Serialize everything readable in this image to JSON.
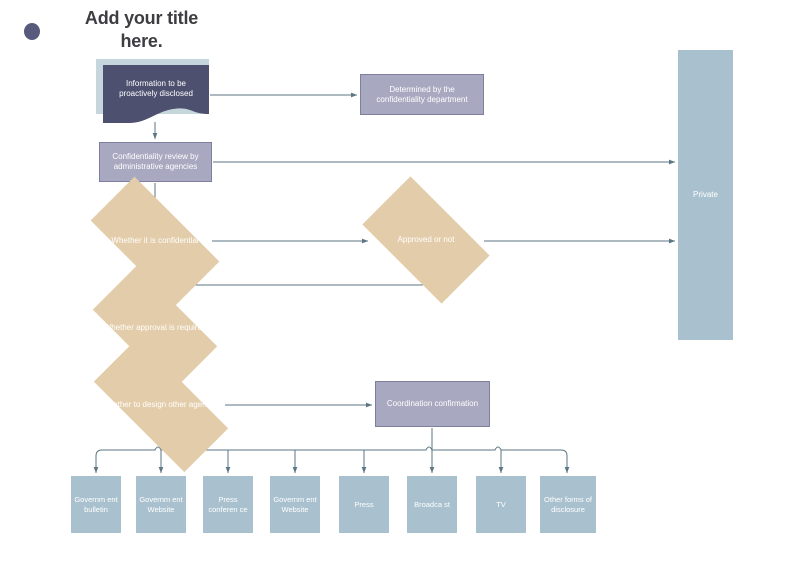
{
  "title": {
    "text": "Add your title here.",
    "bullet_icon": "circle-bullet-icon"
  },
  "colors": {
    "dark_slate": "#4e5070",
    "light_blue_shadow": "#c5d6dd",
    "purple": "#a8a8c0",
    "purple_border": "#7e7f9e",
    "tan": "#e3cca9",
    "blue_gray": "#a9c1ce",
    "connector": "#5c7683",
    "title_text": "#3d3d42",
    "node_text": "#ffffff"
  },
  "nodes": {
    "start_document": "Information to be proactively disclosed",
    "determined": "Determined by the confidentiality department",
    "review": "Confidentiality review by administrative agencies",
    "private": "Private",
    "coordination": "Coordination confirmation"
  },
  "decisions": [
    {
      "id": "whether-confidential",
      "label": "Whether it is confidential"
    },
    {
      "id": "approved-or-not",
      "label": "Approved or not"
    },
    {
      "id": "whether-approval-required",
      "label": "Whether approval is required"
    },
    {
      "id": "whether-design-other",
      "label": "Whether to design other agencies"
    }
  ],
  "outputs": [
    {
      "id": "government-bulletin",
      "label": "Governm ent bulletin"
    },
    {
      "id": "government-website-1",
      "label": "Governm ent Website"
    },
    {
      "id": "press-conference",
      "label": "Press conferen ce"
    },
    {
      "id": "government-website-2",
      "label": "Governm ent Website"
    },
    {
      "id": "press",
      "label": "Press"
    },
    {
      "id": "broadcast",
      "label": "Broadca st"
    },
    {
      "id": "tv",
      "label": "TV"
    },
    {
      "id": "other-forms",
      "label": "Other forms of disclosure"
    }
  ]
}
